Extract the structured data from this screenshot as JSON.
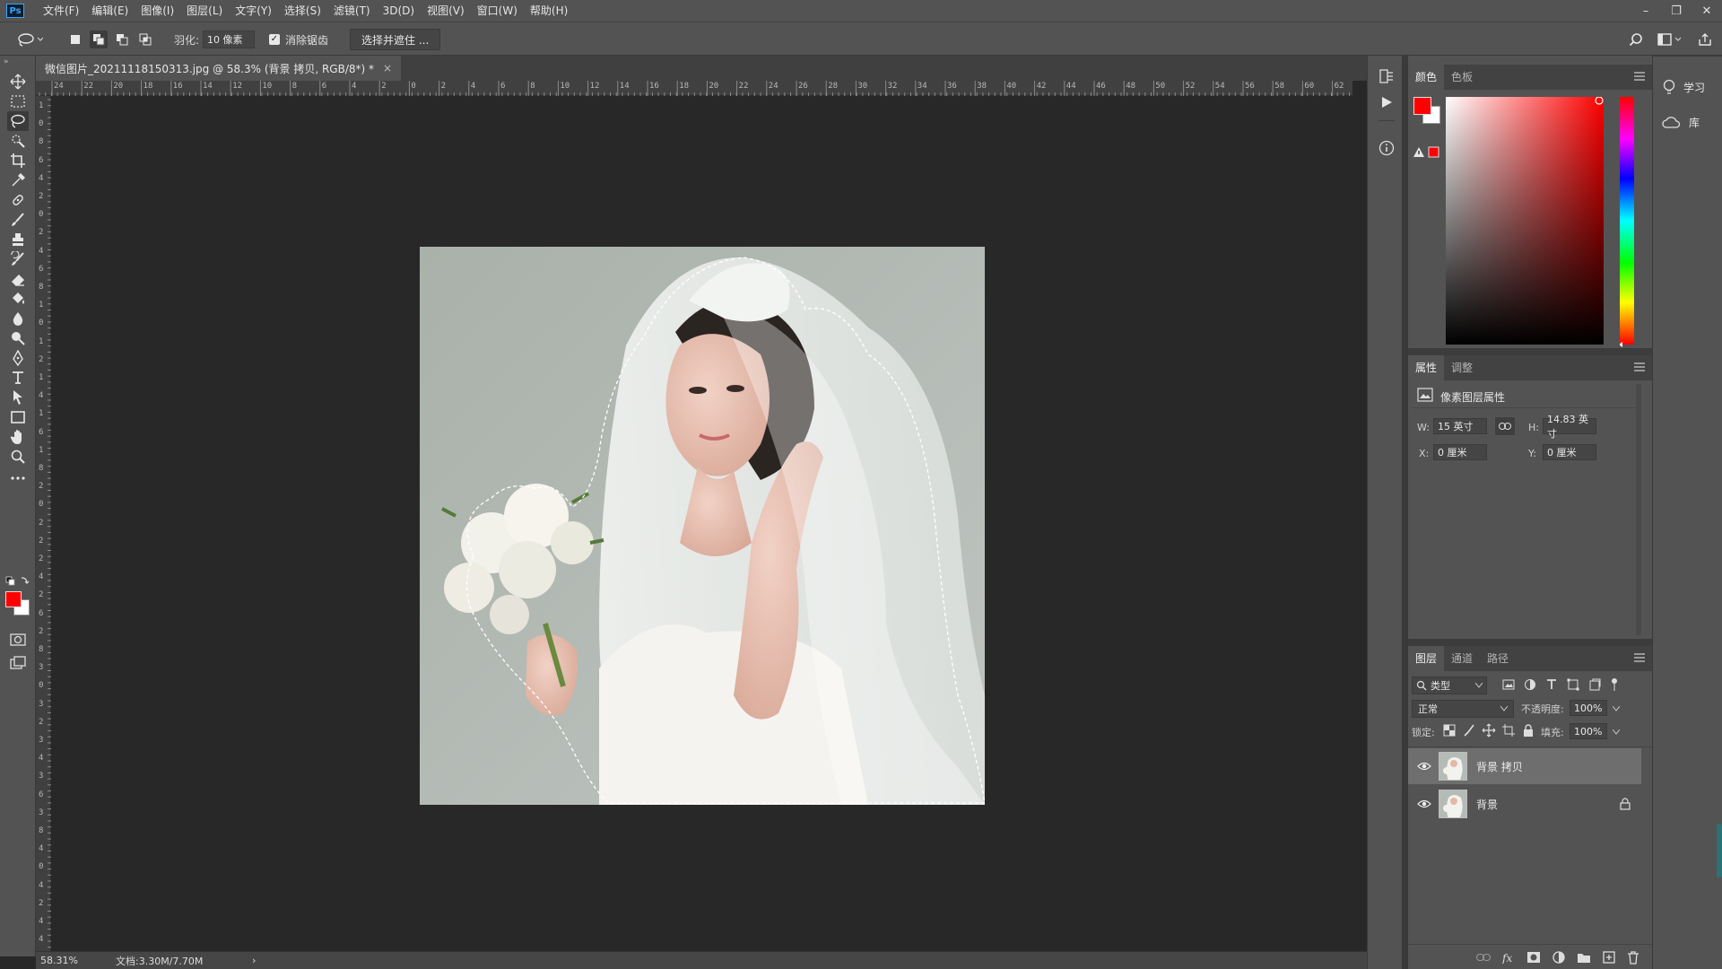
{
  "app": {
    "logo": "Ps"
  },
  "menu": [
    "文件(F)",
    "编辑(E)",
    "图像(I)",
    "图层(L)",
    "文字(Y)",
    "选择(S)",
    "滤镜(T)",
    "3D(D)",
    "视图(V)",
    "窗口(W)",
    "帮助(H)"
  ],
  "window_controls": {
    "minimize": "–",
    "restore": "❐",
    "close": "✕"
  },
  "options": {
    "feather_label": "羽化:",
    "feather_value": "10 像素",
    "antialias_label": "消除锯齿",
    "antialias_checked": true,
    "select_mask_label": "选择并遮住 ..."
  },
  "document": {
    "tab_title": "微信图片_20211118150313.jpg @ 58.3% (背景 拷贝, RGB/8*) *",
    "close": "×"
  },
  "ruler": {
    "h_labels": [
      "24",
      "22",
      "20",
      "18",
      "16",
      "14",
      "12",
      "10",
      "8",
      "6",
      "4",
      "2",
      "0",
      "2",
      "4",
      "6",
      "8",
      "10",
      "12",
      "14",
      "16",
      "18",
      "20",
      "22",
      "24",
      "26",
      "28",
      "30",
      "32",
      "34",
      "36",
      "38",
      "40",
      "42",
      "44",
      "46",
      "48",
      "50",
      "52",
      "54",
      "56",
      "58",
      "60",
      "62"
    ],
    "v_labels": [
      "1",
      "0",
      "8",
      "6",
      "4",
      "2",
      "0",
      "2",
      "4",
      "6",
      "8",
      "1",
      "0",
      "1",
      "2",
      "1",
      "4",
      "1",
      "6",
      "1",
      "8",
      "2",
      "0",
      "2",
      "2",
      "2",
      "4",
      "2",
      "6",
      "2",
      "8",
      "3",
      "0",
      "3",
      "2",
      "3",
      "4",
      "3",
      "6",
      "3",
      "8",
      "4",
      "0",
      "4",
      "2",
      "4",
      "4"
    ]
  },
  "status": {
    "zoom": "58.31%",
    "doc_info": "文档:3.30M/7.70M",
    "arrow": "›"
  },
  "colors": {
    "foreground": "#ff0000",
    "background": "#ffffff",
    "accent": "#31a8ff",
    "selection_hue": "#ff0000"
  },
  "color_panel": {
    "tabs": [
      "颜色",
      "色板"
    ],
    "active": 0
  },
  "properties_panel": {
    "tabs": [
      "属性",
      "调整"
    ],
    "active": 0,
    "header": "像素图层属性",
    "w_label": "W:",
    "w_value": "15 英寸",
    "h_label": "H:",
    "h_value": "14.83 英寸",
    "x_label": "X:",
    "x_value": "0 厘米",
    "y_label": "Y:",
    "y_value": "0 厘米"
  },
  "layers_panel": {
    "tabs": [
      "图层",
      "通道",
      "路径"
    ],
    "active": 0,
    "filter_kind": "类型",
    "blend_mode": "正常",
    "opacity_label": "不透明度:",
    "opacity_value": "100%",
    "lock_label": "锁定:",
    "fill_label": "填充:",
    "fill_value": "100%",
    "layers": [
      {
        "name": "背景 拷贝",
        "visible": true,
        "selected": true,
        "locked": false
      },
      {
        "name": "背景",
        "visible": true,
        "selected": false,
        "locked": true
      }
    ]
  },
  "far_right": {
    "learn": "学习",
    "library": "库"
  },
  "tools": [
    "move-tool-icon",
    "marquee-tool-icon",
    "lasso-tool-icon",
    "quick-select-tool-icon",
    "crop-tool-icon",
    "eyedropper-tool-icon",
    "healing-brush-tool-icon",
    "brush-tool-icon",
    "clone-stamp-tool-icon",
    "history-brush-tool-icon",
    "eraser-tool-icon",
    "paint-bucket-tool-icon",
    "blur-tool-icon",
    "dodge-tool-icon",
    "pen-tool-icon",
    "type-tool-icon",
    "path-select-tool-icon",
    "rectangle-tool-icon",
    "hand-tool-icon",
    "zoom-tool-icon",
    "more-tools-icon"
  ]
}
